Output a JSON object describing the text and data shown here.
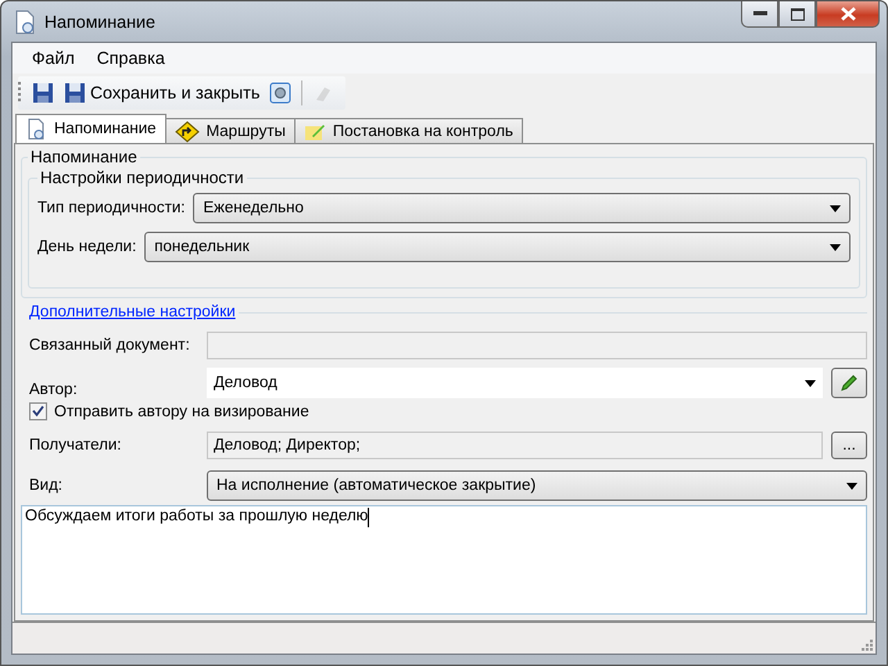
{
  "window": {
    "title": "Напоминание"
  },
  "menu": [
    "Файл",
    "Справка"
  ],
  "toolbar": [
    {
      "kind": "save",
      "disabled": false
    },
    {
      "kind": "save_close",
      "label": "Сохранить и закрыть",
      "disabled": false
    },
    {
      "kind": "settings",
      "disabled": false
    },
    {
      "kind": "tool",
      "disabled": true
    }
  ],
  "tabs": [
    {
      "label": "Напоминание",
      "selected": true
    },
    {
      "label": "Маршруты",
      "selected": false
    },
    {
      "label": "Постановка на контроль",
      "selected": false
    }
  ],
  "reminder_group": {
    "title": "Напоминание",
    "periodicity": {
      "title": "Настройки периодичности",
      "fields": [
        {
          "label": "Тип периодичности:",
          "value": "Еженедельно"
        },
        {
          "label": "День недели:",
          "value": "понедельник"
        }
      ]
    }
  },
  "advanced_link": "Дополнительные настройки",
  "linked_document": {
    "label": "Связанный документ:"
  },
  "author": {
    "label": "Автор:",
    "value": "Деловод"
  },
  "send_for_approval": {
    "label": "Отправить автору на визирование",
    "checked": true
  },
  "recipients": {
    "label": "Получатели:",
    "value": "Деловод; Директор;",
    "button": "..."
  },
  "type": {
    "label": "Вид:",
    "value": "На исполнение (автоматическое закрытие)"
  },
  "memo": "Обсуждаем итоги работы за прошлую неделю"
}
